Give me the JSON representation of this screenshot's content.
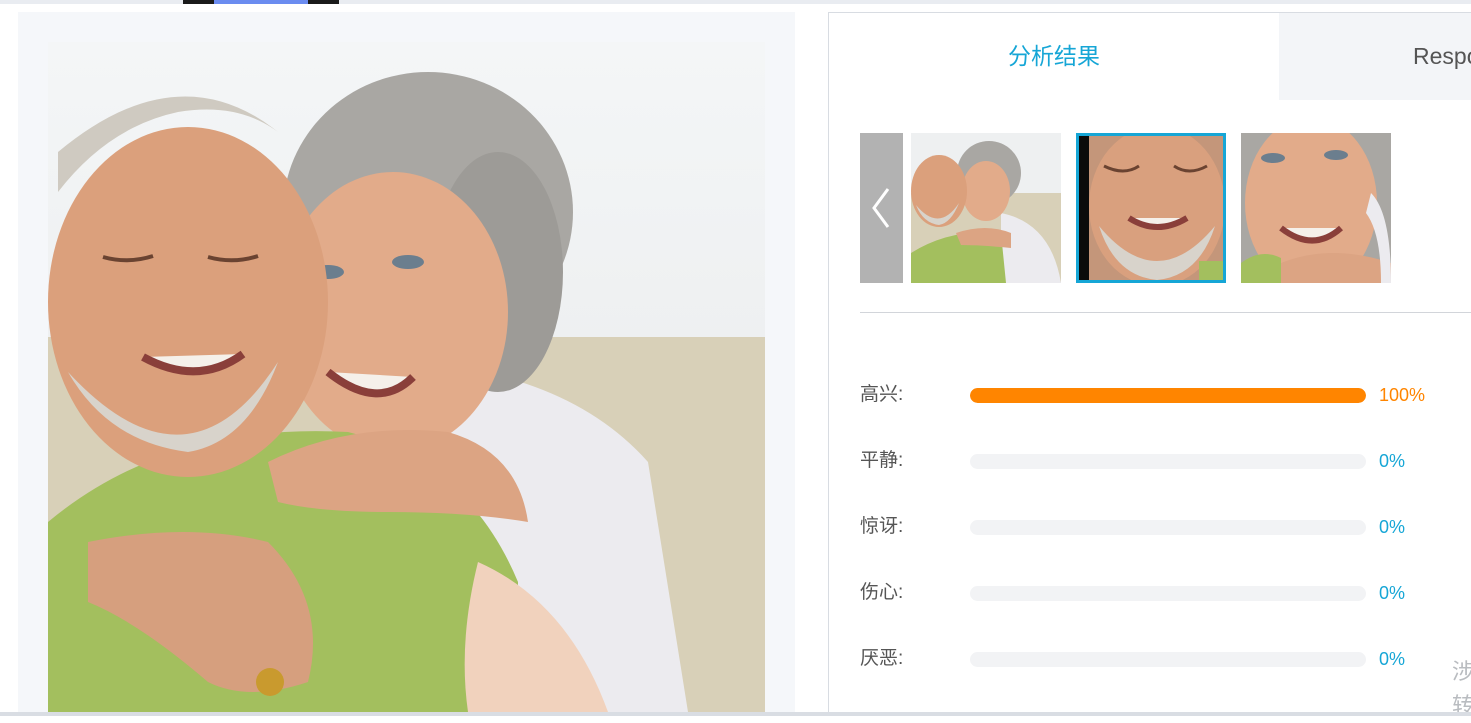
{
  "tabs": [
    {
      "label": "分析结果",
      "active": true
    },
    {
      "label": "Respo",
      "active": false
    }
  ],
  "thumbnails": [
    {
      "name": "couple-photo",
      "selected": false
    },
    {
      "name": "man-face",
      "selected": true
    },
    {
      "name": "woman-face",
      "selected": false
    }
  ],
  "emotions": [
    {
      "label": "高兴:",
      "value": "100%",
      "fraction": 1.0
    },
    {
      "label": "平静:",
      "value": "0%",
      "fraction": 0.0
    },
    {
      "label": "惊讶:",
      "value": "0%",
      "fraction": 0.0
    },
    {
      "label": "伤心:",
      "value": "0%",
      "fraction": 0.0
    },
    {
      "label": "厌恶:",
      "value": "0%",
      "fraction": 0.0
    }
  ],
  "edge_text": "涉 转",
  "colors": {
    "accent": "#16a6d6",
    "bar_fill": "#ff8500",
    "bar_track": "#f2f3f5"
  },
  "icons": {
    "prev": "chevron-left-icon"
  }
}
